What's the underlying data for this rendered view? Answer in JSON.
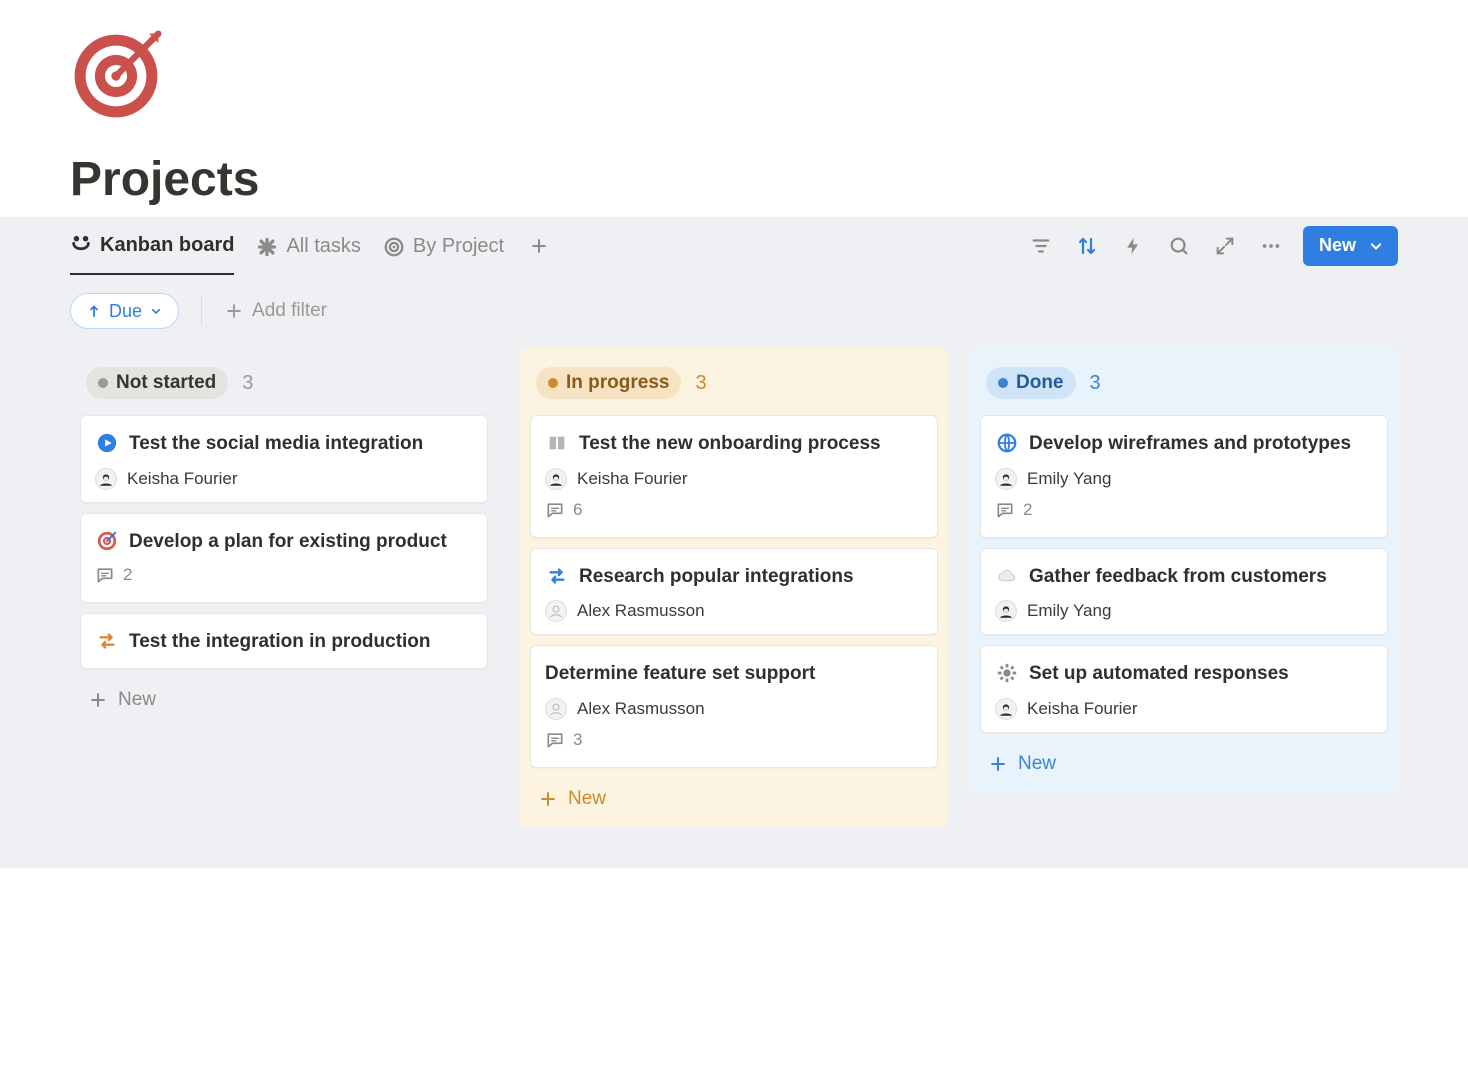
{
  "page": {
    "title": "Projects",
    "icon": "target-icon",
    "icon_color": "#c9504b"
  },
  "views": {
    "tabs": [
      {
        "label": "Kanban board",
        "icon": "board-icon",
        "active": true
      },
      {
        "label": "All tasks",
        "icon": "asterisk-icon",
        "active": false
      },
      {
        "label": "By Project",
        "icon": "target-small-icon",
        "active": false
      }
    ],
    "new_label": "New"
  },
  "filters": {
    "due_label": "Due",
    "add_filter_label": "Add filter"
  },
  "board": {
    "columns": [
      {
        "id": "not_started",
        "label": "Not started",
        "count": "3",
        "new_label": "New",
        "cards": [
          {
            "icon": "play-circle-icon",
            "title": "Test the social media integration",
            "assignee": "Keisha Fourier",
            "comments": null
          },
          {
            "icon": "dart-icon",
            "title": "Develop a plan for existing product",
            "assignee": null,
            "comments": "2"
          },
          {
            "icon": "swap-icon",
            "title": "Test the integration in production",
            "assignee": null,
            "comments": null
          }
        ]
      },
      {
        "id": "in_progress",
        "label": "In progress",
        "count": "3",
        "new_label": "New",
        "cards": [
          {
            "icon": "book-icon",
            "title": "Test the new onboarding process",
            "assignee": "Keisha Fourier",
            "comments": "6"
          },
          {
            "icon": "swap-blue-icon",
            "title": "Research popular integrations",
            "assignee": "Alex Rasmusson",
            "comments": null
          },
          {
            "icon": null,
            "title": "Determine feature set support",
            "assignee": "Alex Rasmusson",
            "comments": "3"
          }
        ]
      },
      {
        "id": "done",
        "label": "Done",
        "count": "3",
        "new_label": "New",
        "cards": [
          {
            "icon": "globe-icon",
            "title": "Develop wireframes and prototypes",
            "assignee": "Emily Yang",
            "comments": "2"
          },
          {
            "icon": "cloud-icon",
            "title": "Gather feedback from customers",
            "assignee": "Emily Yang",
            "comments": null
          },
          {
            "icon": "gear-icon",
            "title": "Set up automated responses",
            "assignee": "Keisha Fourier",
            "comments": null
          }
        ]
      }
    ]
  }
}
